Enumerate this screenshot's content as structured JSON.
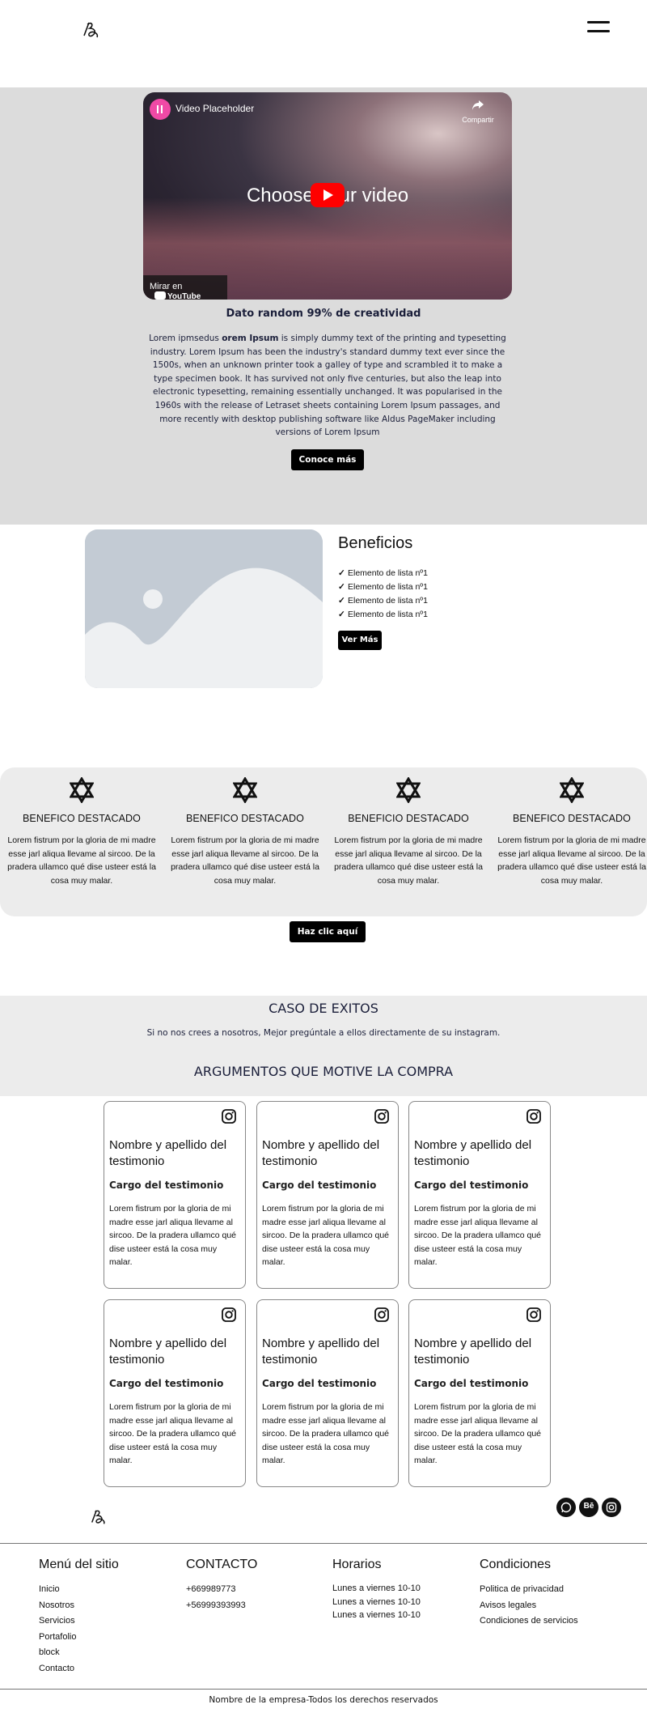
{
  "header": {
    "logo_icon": "signature-logo-icon",
    "menu_icon": "hamburger-menu-icon"
  },
  "video": {
    "title": "Video Placeholder",
    "share_label": "Compartir",
    "caption": "Choose your video",
    "watch_on": "Mirar en",
    "youtube_label": "YouTube"
  },
  "hero": {
    "title": "Dato random 99% de creatividad",
    "text_bold": "orem Ipsum",
    "text_before": "Lorem ipmsedus ",
    "text_after": " is simply dummy text of the printing and typesetting industry. Lorem Ipsum has been the industry's standard dummy text ever since the 1500s, when an unknown printer took a galley of type and scrambled it to make a type specimen book. It has survived not only five centuries, but also the leap into electronic typesetting, remaining essentially unchanged. It was popularised in the 1960s with the release of Letraset sheets containing Lorem Ipsum passages, and more recently with desktop publishing software like Aldus PageMaker including versions of Lorem Ipsum",
    "button": "Conoce más"
  },
  "beneficios": {
    "title": "Beneficios",
    "items": [
      "Elemento de lista nº1",
      "Elemento de lista nº1",
      "Elemento de lista nº1",
      "Elemento de lista nº1"
    ],
    "check_icon": "check-icon",
    "button": "Ver Más"
  },
  "destacados": {
    "icon": "star-of-david-icon",
    "items": [
      {
        "title": "BENEFICO DESTACADO",
        "text": "Lorem fistrum por la gloria de mi madre esse jarl aliqua llevame al sircoo. De la pradera ullamco qué dise usteer está la cosa muy malar."
      },
      {
        "title": "BENEFICO DESTACADO",
        "text": "Lorem fistrum por la gloria de mi madre esse jarl aliqua llevame al sircoo. De la pradera ullamco qué dise usteer está la cosa muy malar."
      },
      {
        "title": "BENEFICIO DESTACADO",
        "text": "Lorem fistrum por la gloria de mi madre esse jarl aliqua llevame al sircoo. De la pradera ullamco qué dise usteer está la cosa muy malar."
      },
      {
        "title": "BENEFICO DESTACADO",
        "text": "Lorem fistrum por la gloria de mi madre esse jarl aliqua llevame al sircoo. De la pradera ullamco qué dise usteer está la cosa muy malar."
      }
    ],
    "button": "Haz clic aquí"
  },
  "casos": {
    "title": "CASO DE EXITOS",
    "subtitle": "Si no nos crees a nosotros, Mejor pregúntale a ellos directamente de su instagram.",
    "args_title": "ARGUMENTOS QUE MOTIVE LA COMPRA"
  },
  "testimonios": [
    {
      "name": "Nombre y apellido del testimonio",
      "role": "Cargo del testimonio",
      "text": "Lorem fistrum por la gloria de mi madre esse jarl aliqua llevame al sircoo. De la pradera ullamco qué dise usteer está la cosa muy malar."
    },
    {
      "name": "Nombre y apellido del testimonio",
      "role": "Cargo del testimonio",
      "text": "Lorem fistrum por la gloria de mi madre esse jarl aliqua llevame al sircoo. De la pradera ullamco qué dise usteer está la cosa muy malar."
    },
    {
      "name": "Nombre y apellido del testimonio",
      "role": "Cargo del testimonio",
      "text": "Lorem fistrum por la gloria de mi madre esse jarl aliqua llevame al sircoo. De la pradera ullamco qué dise usteer está la cosa muy malar."
    },
    {
      "name": "Nombre y apellido del testimonio",
      "role": "Cargo del testimonio",
      "text": "Lorem fistrum por la gloria de mi madre esse jarl aliqua llevame al sircoo. De la pradera ullamco qué dise usteer está la cosa muy malar."
    },
    {
      "name": "Nombre y apellido del testimonio",
      "role": "Cargo del testimonio",
      "text": "Lorem fistrum por la gloria de mi madre esse jarl aliqua llevame al sircoo. De la pradera ullamco qué dise usteer está la cosa muy malar."
    },
    {
      "name": "Nombre y apellido del testimonio",
      "role": "Cargo del testimonio",
      "text": "Lorem fistrum por la gloria de mi madre esse jarl aliqua llevame al sircoo. De la pradera ullamco qué dise usteer está la cosa muy malar."
    }
  ],
  "social": {
    "whatsapp_icon": "whatsapp-icon",
    "behance_label": "Bē",
    "instagram_icon": "instagram-icon"
  },
  "footer": {
    "menu": {
      "title": "Menú del sitio",
      "items": [
        "Inicio",
        "Nosotros",
        "Servicios",
        "Portafolio",
        "block",
        "Contacto"
      ]
    },
    "contacto": {
      "title": "CONTACTO",
      "items": [
        "+669989773",
        "+56999393993"
      ]
    },
    "horarios": {
      "title": "Horarios",
      "items": [
        "Lunes a viernes 10-10",
        "Lunes a viernes 10-10",
        "Lunes a viernes 10-10"
      ]
    },
    "condiciones": {
      "title": "Condiciones",
      "items": [
        "Politica de privacidad",
        "Avisos legales",
        "Condiciones de servicios"
      ]
    },
    "copyright": "Nombre de la empresa-Todos los derechos reservados"
  },
  "colors": {
    "hero_bg": "#dcdcdc",
    "band_bg": "#ececec",
    "button_bg": "#000000",
    "heading_color": "#1b1f3a",
    "play_red": "#ff0000"
  }
}
